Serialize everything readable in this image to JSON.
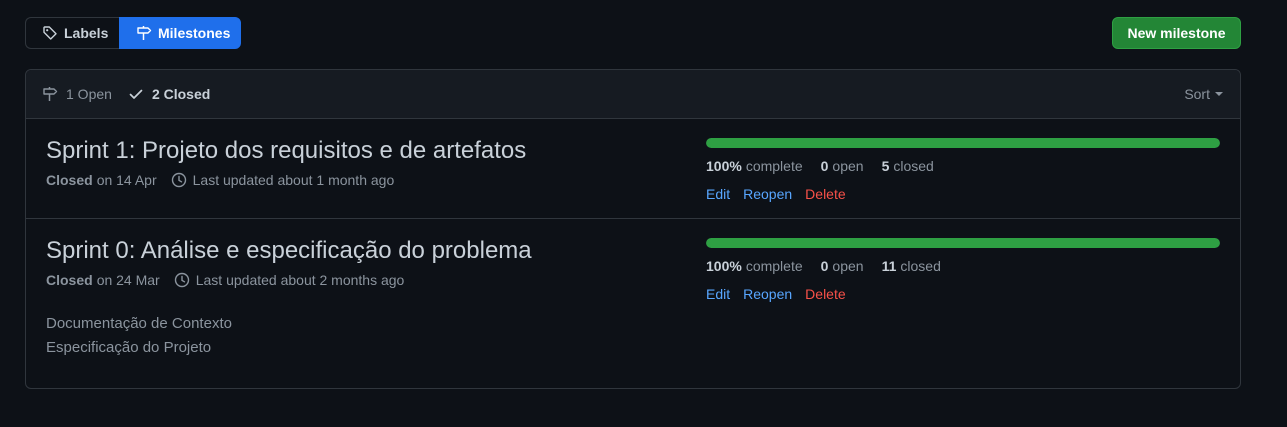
{
  "tabs": {
    "labels": "Labels",
    "milestones": "Milestones"
  },
  "new_milestone": "New milestone",
  "filters": {
    "open": "1 Open",
    "closed": "2 Closed",
    "sort": "Sort"
  },
  "milestones": [
    {
      "title": "Sprint 1: Projeto dos requisitos e de artefatos",
      "status": "Closed",
      "date": "on 14 Apr",
      "updated": "Last updated about 1 month ago",
      "percent": "100%",
      "complete_label": "complete",
      "open_count": "0",
      "open_label": "open",
      "closed_count": "5",
      "closed_label": "closed",
      "progress": 1.0,
      "actions": {
        "edit": "Edit",
        "reopen": "Reopen",
        "delete": "Delete"
      },
      "description": []
    },
    {
      "title": "Sprint 0: Análise e especificação do problema",
      "status": "Closed",
      "date": "on 24 Mar",
      "updated": "Last updated about 2 months ago",
      "percent": "100%",
      "complete_label": "complete",
      "open_count": "0",
      "open_label": "open",
      "closed_count": "11",
      "closed_label": "closed",
      "progress": 1.0,
      "actions": {
        "edit": "Edit",
        "reopen": "Reopen",
        "delete": "Delete"
      },
      "description": [
        "Documentação de Contexto",
        "Especificação do Projeto"
      ]
    }
  ],
  "colors": {
    "background": "#0d1117",
    "accent": "#1f6feb",
    "success": "#238636",
    "progress": "#2ea043",
    "link": "#58a6ff",
    "danger": "#f85149"
  },
  "icons": [
    "tag-icon",
    "milestone-icon",
    "check-icon",
    "clock-icon",
    "caret-down-icon"
  ]
}
